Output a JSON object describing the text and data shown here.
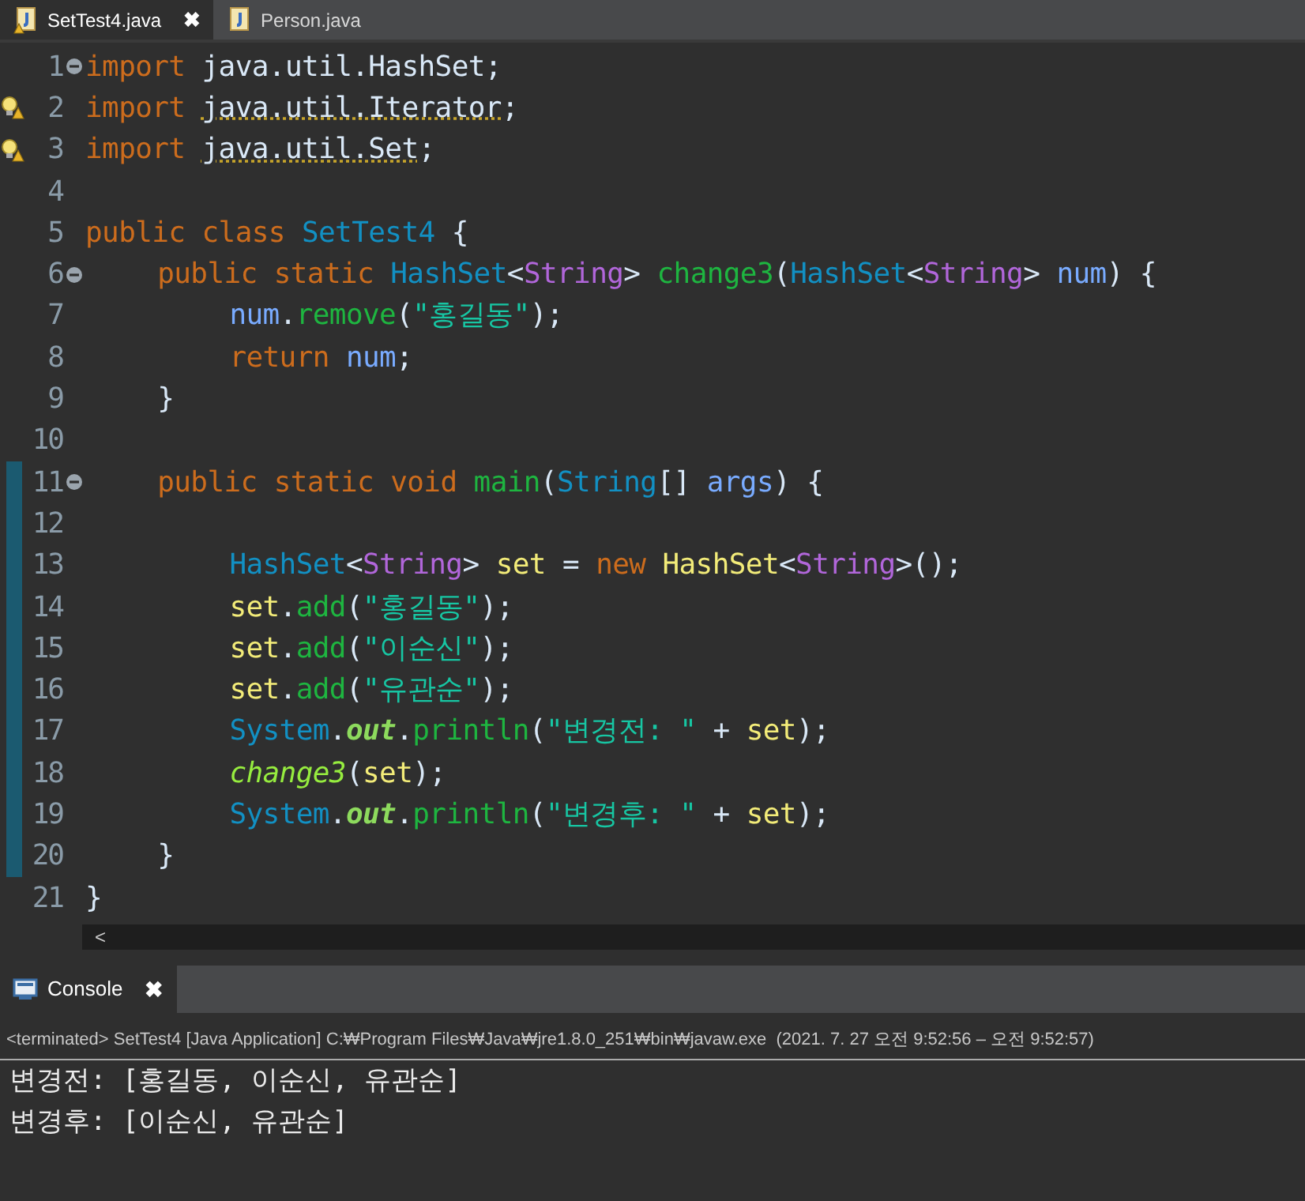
{
  "editor_tabs": [
    {
      "label": "SetTest4.java",
      "selected": true,
      "warning": true,
      "close": "✖"
    },
    {
      "label": "Person.java",
      "selected": false,
      "warning": false
    }
  ],
  "code_lines": [
    {
      "n": "1",
      "fold": true,
      "warning": false,
      "changed": false,
      "tokens": [
        {
          "text": "import",
          "kind": "kw"
        },
        {
          "text": " java.util.HashSet;",
          "kind": "plain"
        }
      ]
    },
    {
      "n": "2",
      "fold": false,
      "warning": true,
      "changed": false,
      "tokens": [
        {
          "text": "import ",
          "kind": "kw"
        },
        {
          "text": "java.util.Iterator",
          "kind": "warn"
        },
        {
          "text": ";",
          "kind": "plain"
        }
      ]
    },
    {
      "n": "3",
      "fold": false,
      "warning": true,
      "changed": false,
      "tokens": [
        {
          "text": "import ",
          "kind": "kw"
        },
        {
          "text": "java.util.Set",
          "kind": "warn"
        },
        {
          "text": ";",
          "kind": "plain"
        }
      ]
    },
    {
      "n": "4",
      "fold": false,
      "warning": false,
      "changed": false
    },
    {
      "n": "5",
      "fold": false,
      "warning": false,
      "changed": false,
      "tokens": [
        {
          "text": "public class ",
          "kind": "kw"
        },
        {
          "text": "SetTest4",
          "kind": "type"
        },
        {
          "text": " {",
          "kind": "plain"
        }
      ],
      "children": [
        {
          "n": "6",
          "fold": true,
          "warning": false,
          "changed": false,
          "tokens": [
            {
              "text": "public static ",
              "kind": "kw"
            },
            {
              "text": "HashSet",
              "kind": "type"
            },
            {
              "text": "<",
              "kind": "plain"
            },
            {
              "text": "String",
              "kind": "generic"
            },
            {
              "text": "> ",
              "kind": "plain"
            },
            {
              "text": "change3",
              "kind": "method"
            },
            {
              "text": "(",
              "kind": "plain"
            },
            {
              "text": "HashSet",
              "kind": "type"
            },
            {
              "text": "<",
              "kind": "plain"
            },
            {
              "text": "String",
              "kind": "generic"
            },
            {
              "text": "> ",
              "kind": "plain"
            },
            {
              "text": "num",
              "kind": "param"
            },
            {
              "text": ") {",
              "kind": "plain"
            }
          ],
          "children": [
            {
              "n": "7",
              "fold": false,
              "warning": false,
              "changed": false,
              "tokens": [
                {
                  "text": "num",
                  "kind": "param"
                },
                {
                  "text": ".",
                  "kind": "plain"
                },
                {
                  "text": "remove",
                  "kind": "method"
                },
                {
                  "text": "(",
                  "kind": "plain"
                },
                {
                  "text": "\"홍길동\"",
                  "kind": "string"
                },
                {
                  "text": ");",
                  "kind": "plain"
                }
              ]
            },
            {
              "n": "8",
              "fold": false,
              "warning": false,
              "changed": false,
              "tokens": [
                {
                  "text": "return ",
                  "kind": "kw"
                },
                {
                  "text": "num",
                  "kind": "param"
                },
                {
                  "text": ";",
                  "kind": "plain"
                }
              ]
            }
          ]
        },
        {
          "n": "9",
          "fold": false,
          "warning": false,
          "changed": false,
          "tokens": [
            {
              "text": "}",
              "kind": "plain"
            }
          ]
        },
        {
          "n": "10",
          "fold": false,
          "warning": false,
          "changed": false
        },
        {
          "n": "11",
          "fold": true,
          "warning": false,
          "changed": true,
          "tokens": [
            {
              "text": "public static void ",
              "kind": "kw"
            },
            {
              "text": "main",
              "kind": "method"
            },
            {
              "text": "(",
              "kind": "plain"
            },
            {
              "text": "String",
              "kind": "type"
            },
            {
              "text": "[] ",
              "kind": "plain"
            },
            {
              "text": "args",
              "kind": "param"
            },
            {
              "text": ") {",
              "kind": "plain"
            }
          ],
          "children": [
            {
              "n": "12",
              "fold": false,
              "warning": false,
              "changed": true
            },
            {
              "n": "13",
              "fold": false,
              "warning": false,
              "changed": true,
              "tokens": [
                {
                  "text": "HashSet",
                  "kind": "type"
                },
                {
                  "text": "<",
                  "kind": "plain"
                },
                {
                  "text": "String",
                  "kind": "generic"
                },
                {
                  "text": "> ",
                  "kind": "plain"
                },
                {
                  "text": "set",
                  "kind": "local"
                },
                {
                  "text": " = ",
                  "kind": "plain"
                },
                {
                  "text": "new ",
                  "kind": "kw"
                },
                {
                  "text": "HashSet",
                  "kind": "local"
                },
                {
                  "text": "<",
                  "kind": "plain"
                },
                {
                  "text": "String",
                  "kind": "generic"
                },
                {
                  "text": ">();",
                  "kind": "plain"
                }
              ]
            },
            {
              "n": "14",
              "fold": false,
              "warning": false,
              "changed": true,
              "tokens": [
                {
                  "text": "set",
                  "kind": "local"
                },
                {
                  "text": ".",
                  "kind": "plain"
                },
                {
                  "text": "add",
                  "kind": "method"
                },
                {
                  "text": "(",
                  "kind": "plain"
                },
                {
                  "text": "\"홍길동\"",
                  "kind": "string"
                },
                {
                  "text": ");",
                  "kind": "plain"
                }
              ]
            },
            {
              "n": "15",
              "fold": false,
              "warning": false,
              "changed": true,
              "tokens": [
                {
                  "text": "set",
                  "kind": "local"
                },
                {
                  "text": ".",
                  "kind": "plain"
                },
                {
                  "text": "add",
                  "kind": "method"
                },
                {
                  "text": "(",
                  "kind": "plain"
                },
                {
                  "text": "\"이순신\"",
                  "kind": "string"
                },
                {
                  "text": ");",
                  "kind": "plain"
                }
              ]
            },
            {
              "n": "16",
              "fold": false,
              "warning": false,
              "changed": true,
              "tokens": [
                {
                  "text": "set",
                  "kind": "local"
                },
                {
                  "text": ".",
                  "kind": "plain"
                },
                {
                  "text": "add",
                  "kind": "method"
                },
                {
                  "text": "(",
                  "kind": "plain"
                },
                {
                  "text": "\"유관순\"",
                  "kind": "string"
                },
                {
                  "text": ");",
                  "kind": "plain"
                }
              ]
            },
            {
              "n": "17",
              "fold": false,
              "warning": false,
              "changed": true,
              "tokens": [
                {
                  "text": "System",
                  "kind": "type"
                },
                {
                  "text": ".",
                  "kind": "plain"
                },
                {
                  "text": "out",
                  "kind": "field"
                },
                {
                  "text": ".",
                  "kind": "plain"
                },
                {
                  "text": "println",
                  "kind": "method"
                },
                {
                  "text": "(",
                  "kind": "plain"
                },
                {
                  "text": "\"변경전: \"",
                  "kind": "string"
                },
                {
                  "text": " + ",
                  "kind": "plain"
                },
                {
                  "text": "set",
                  "kind": "local"
                },
                {
                  "text": ");",
                  "kind": "plain"
                }
              ]
            },
            {
              "n": "18",
              "fold": false,
              "warning": false,
              "changed": true,
              "tokens": [
                {
                  "text": "change3",
                  "kind": "static"
                },
                {
                  "text": "(",
                  "kind": "plain"
                },
                {
                  "text": "set",
                  "kind": "local"
                },
                {
                  "text": ");",
                  "kind": "plain"
                }
              ]
            },
            {
              "n": "19",
              "fold": false,
              "warning": false,
              "changed": true,
              "tokens": [
                {
                  "text": "System",
                  "kind": "type"
                },
                {
                  "text": ".",
                  "kind": "plain"
                },
                {
                  "text": "out",
                  "kind": "field"
                },
                {
                  "text": ".",
                  "kind": "plain"
                },
                {
                  "text": "println",
                  "kind": "method"
                },
                {
                  "text": "(",
                  "kind": "plain"
                },
                {
                  "text": "\"변경후: \"",
                  "kind": "string"
                },
                {
                  "text": " + ",
                  "kind": "plain"
                },
                {
                  "text": "set",
                  "kind": "local"
                },
                {
                  "text": ");",
                  "kind": "plain"
                }
              ]
            }
          ]
        },
        {
          "n": "20",
          "fold": false,
          "warning": false,
          "changed": true,
          "tokens": [
            {
              "text": "}",
              "kind": "plain"
            }
          ]
        }
      ]
    },
    {
      "n": "21",
      "fold": false,
      "warning": false,
      "changed": false,
      "tokens": [
        {
          "text": "}",
          "kind": "plain"
        }
      ]
    }
  ],
  "horizontal_scroll": {
    "arrow": "<"
  },
  "console": {
    "tab": {
      "label": "Console",
      "close": "✖",
      "selected": true
    },
    "status": "<terminated> SetTest4 [Java Application] C:₩Program Files₩Java₩jre1.8.0_251₩bin₩javaw.exe  (2021. 7. 27 오전 9:52:56 – 오전 9:52:57)",
    "output": [
      "변경전: [홍길동, 이순신, 유관순]",
      "변경후: [이순신, 유관순]"
    ]
  }
}
